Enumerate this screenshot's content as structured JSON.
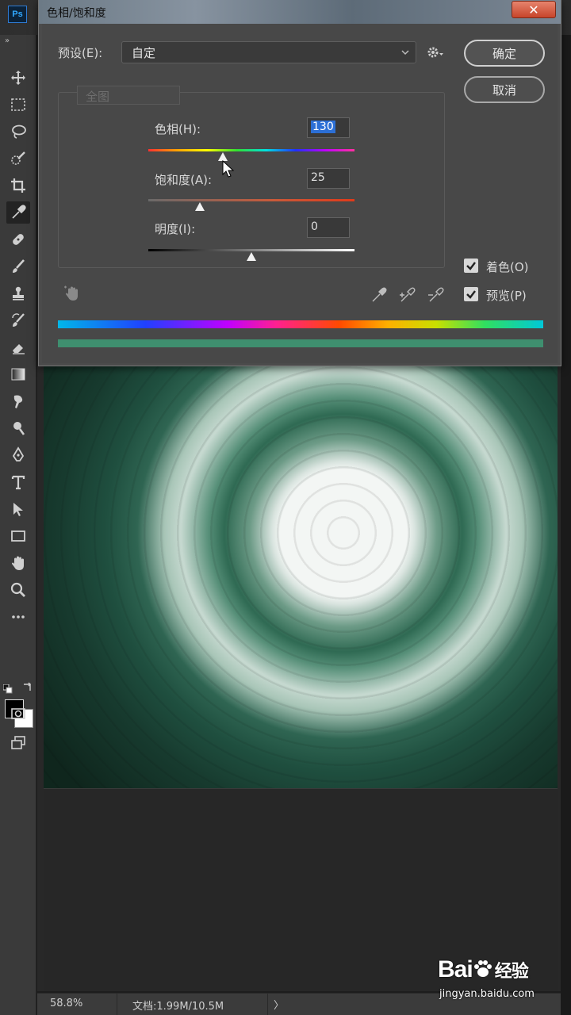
{
  "app": {
    "logo": "Ps"
  },
  "dialog": {
    "title": "色相/饱和度",
    "close_label": "✕",
    "preset_label": "预设(E):",
    "preset_value": "自定",
    "channel_value": "全图",
    "ok_label": "确定",
    "cancel_label": "取消",
    "hue": {
      "label": "色相(H):",
      "value": "130"
    },
    "saturation": {
      "label": "饱和度(A):",
      "value": "25"
    },
    "lightness": {
      "label": "明度(I):",
      "value": "0"
    },
    "colorize": {
      "label": "着色(O)",
      "checked": true
    },
    "preview": {
      "label": "预览(P)",
      "checked": true
    }
  },
  "status": {
    "zoom": "58.8%",
    "doc_info": "文档:1.99M/10.5M",
    "arrow": "〉"
  },
  "watermark": {
    "brand": "Bai",
    "brand_cn": "经验",
    "url": "jingyan.baidu.com"
  },
  "colors": {
    "accent": "#2c6fd6",
    "close": "#c7442a",
    "result_bar": "#3f8f6f"
  }
}
